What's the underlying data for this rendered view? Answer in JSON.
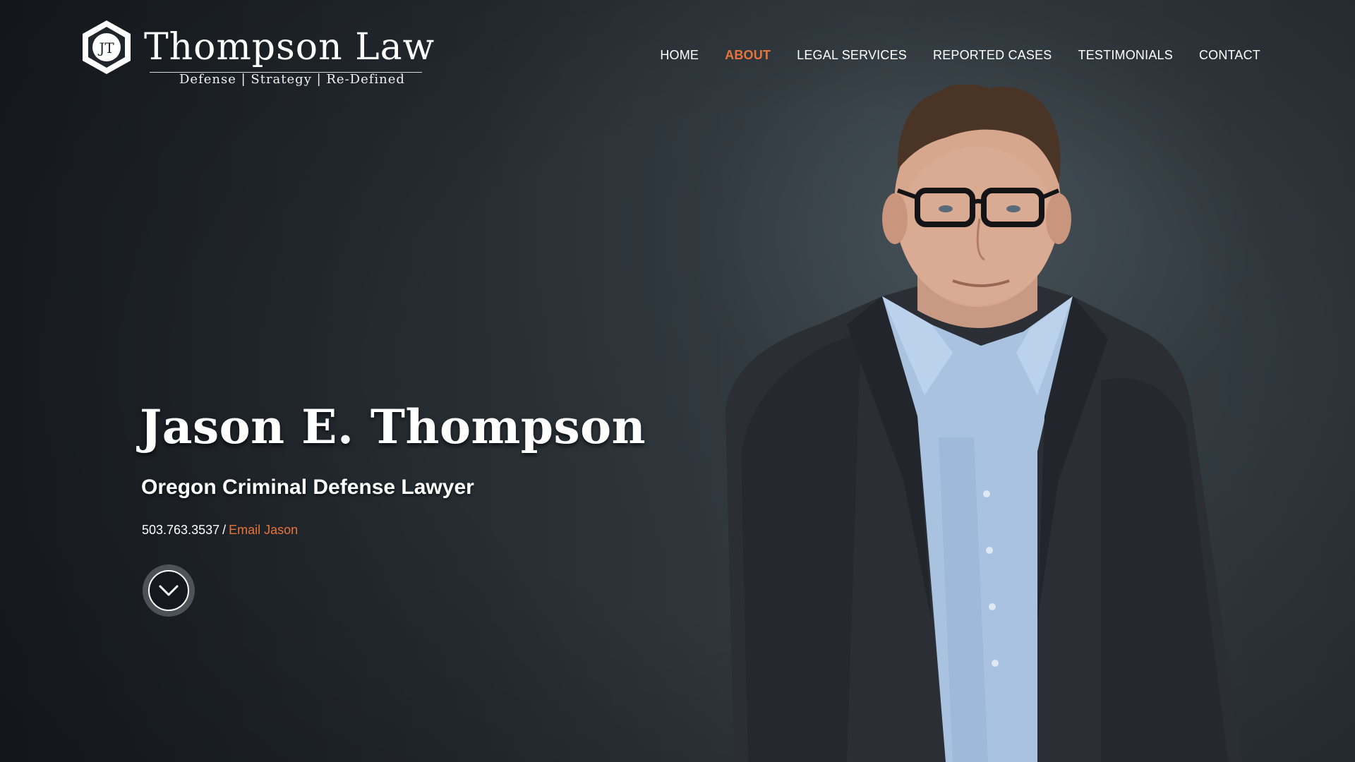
{
  "logo": {
    "monogram": "JT",
    "name": "Thompson Law",
    "tagline": "Defense | Strategy | Re-Defined"
  },
  "nav": {
    "items": [
      {
        "label": "HOME",
        "active": false
      },
      {
        "label": "ABOUT",
        "active": true
      },
      {
        "label": "LEGAL SERVICES",
        "active": false
      },
      {
        "label": "REPORTED CASES",
        "active": false
      },
      {
        "label": "TESTIMONIALS",
        "active": false
      },
      {
        "label": "CONTACT",
        "active": false
      }
    ]
  },
  "hero": {
    "title": "Jason E. Thompson",
    "subtitle": "Oregon Criminal Defense Lawyer",
    "phone": "503.763.3537",
    "separator": "/",
    "email_link": "Email Jason",
    "scroll_icon": "chevron-down-icon"
  },
  "colors": {
    "accent": "#e8743b",
    "background": "#23292f",
    "text": "#ffffff"
  }
}
